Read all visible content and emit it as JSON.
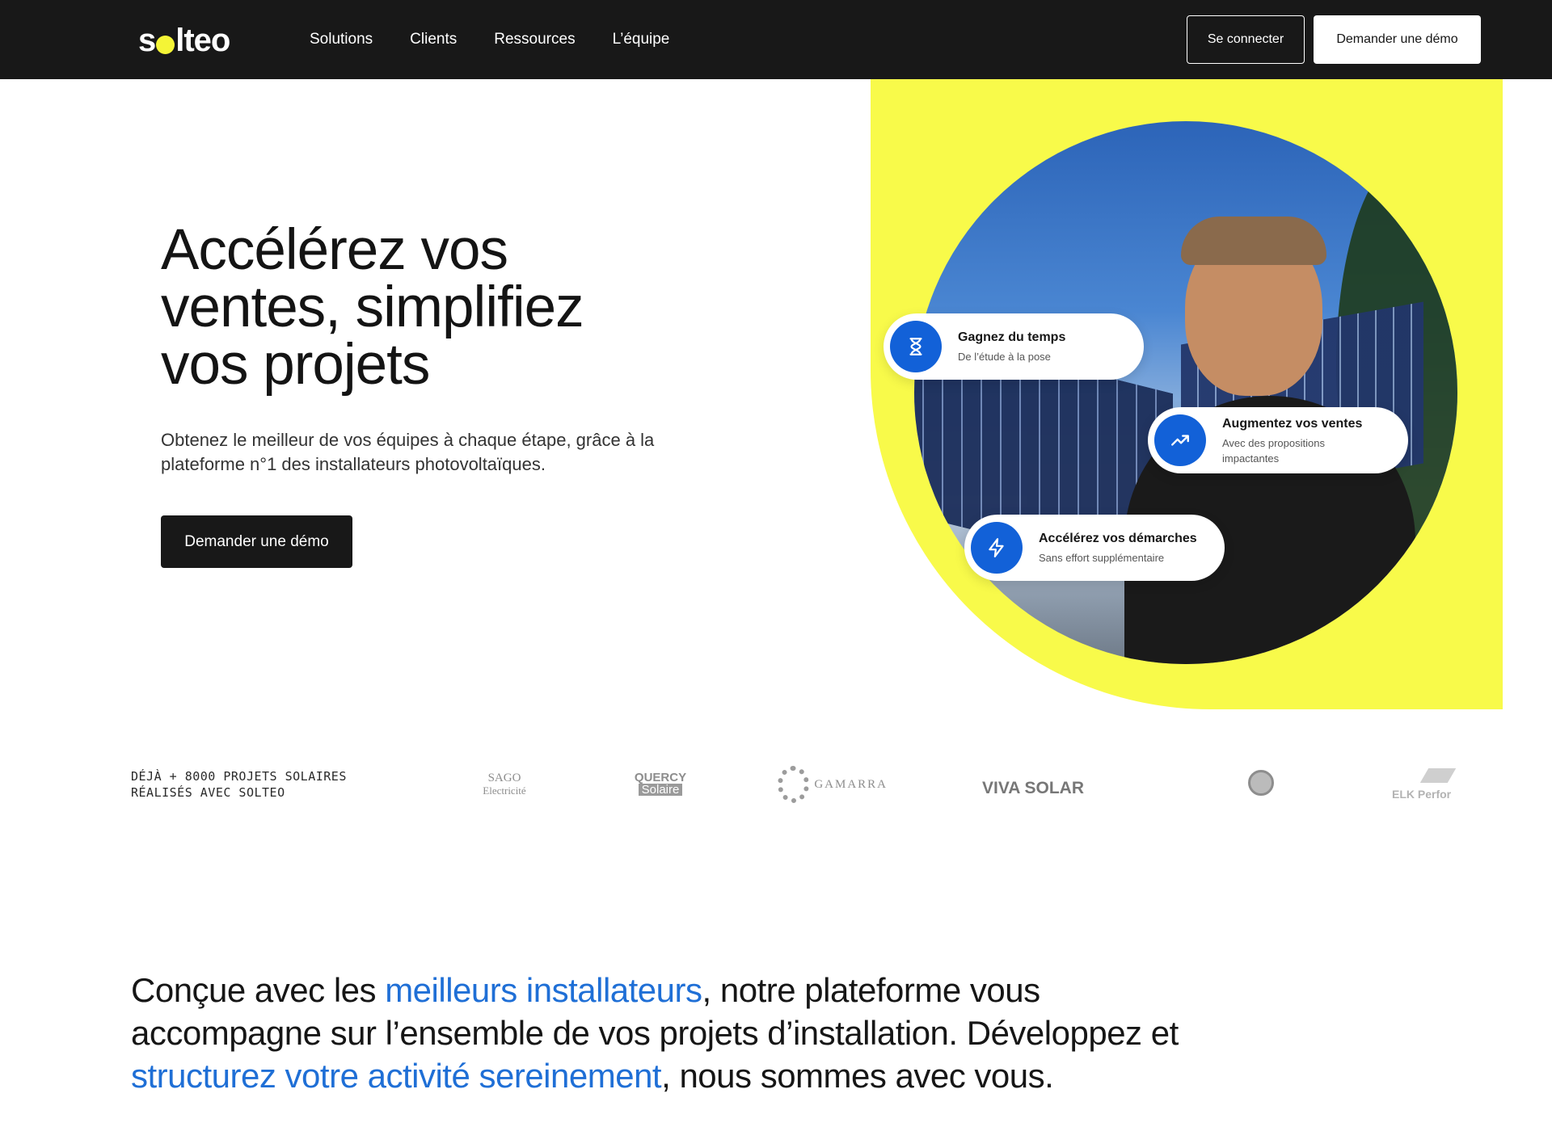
{
  "nav": {
    "logo": {
      "before": "s",
      "after": "lteo"
    },
    "links": [
      "Solutions",
      "Clients",
      "Ressources",
      "L’équipe"
    ],
    "login_label": "Se connecter",
    "demo_label": "Demander une démo"
  },
  "hero": {
    "title_lines": [
      "Accélérez vos",
      "ventes, simplifiez",
      "vos projets"
    ],
    "subtitle": "Obtenez le meilleur de vos équipes à chaque étape, grâce à la plateforme n°1 des installateurs photovoltaïques.",
    "cta_label": "Demander une démo",
    "features": [
      {
        "title": "Gagnez du temps",
        "subtitle": "De l’étude à la pose",
        "icon": "hourglass-icon"
      },
      {
        "title": "Augmentez vos ventes",
        "subtitle": "Avec des propositions impactantes",
        "icon": "trending-up-icon"
      },
      {
        "title": "Accélérez vos démarches",
        "subtitle": "Sans effort supplémentaire",
        "icon": "lightning-icon"
      }
    ]
  },
  "proof": {
    "text_lines": [
      "DÉJÀ + 8000 PROJETS SOLAIRES",
      "RÉALISÉS AVEC SOLTEO"
    ],
    "logos": {
      "sago": [
        "SAGO",
        "Electricité"
      ],
      "quercy": [
        "QUERCY",
        "Solaire"
      ],
      "gamarra": "GAMARRA",
      "viva": "VIVA SOLAR",
      "elk": "ELK Perfor"
    }
  },
  "intro": {
    "p1": "Conçue avec les ",
    "h1": "meilleurs installateurs",
    "p2": ", notre plateforme vous accompagne sur l’ensemble de vos projets d’installation. Développez et ",
    "h2": "structurez votre activité sereinement",
    "p3": ", nous sommes avec vous."
  },
  "colors": {
    "nav_bg": "#181818",
    "accent_yellow": "#f8fa4a",
    "brand_blue": "#1261d8",
    "highlight_blue": "#1f6fd6"
  }
}
